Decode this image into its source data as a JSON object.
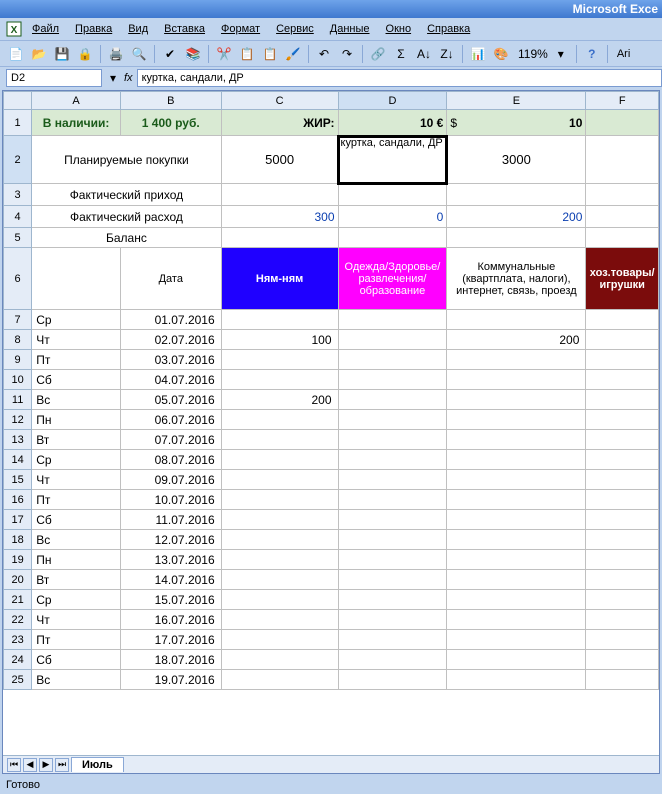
{
  "app": {
    "title": "Microsoft Exce"
  },
  "menu": {
    "file": "Файл",
    "edit": "Правка",
    "view": "Вид",
    "insert": "Вставка",
    "format": "Формат",
    "tools": "Сервис",
    "data": "Данные",
    "window": "Окно",
    "help": "Справка"
  },
  "toolbar": {
    "zoom": "119%",
    "font": "Ari"
  },
  "namebox": {
    "cell": "D2",
    "fx": "fx",
    "formula": "куртка, сандали, ДР"
  },
  "columns": [
    "A",
    "B",
    "C",
    "D",
    "E",
    "F"
  ],
  "row1": {
    "A": "В наличии:",
    "B": "1 400 руб.",
    "C": "ЖИР:",
    "D": "10 €",
    "E_prefix": "$",
    "E_value": "10"
  },
  "row2": {
    "plan_label": "Планируемые покупки",
    "C": "5000",
    "D": "куртка, сандали, ДР",
    "E": "3000"
  },
  "row3": {
    "label": "Фактический приход"
  },
  "row4": {
    "label": "Фактический расход",
    "C": "300",
    "D": "0",
    "E": "200"
  },
  "row5": {
    "label": "Баланс"
  },
  "row6": {
    "date": "Дата",
    "nyam": "Ням-ням",
    "health": "Одежда/Здоровье/развлечения/образование",
    "komm": "Коммунальные (квартплата, налоги), интернет, связь, проезд",
    "hoz": "хоз.товары/игрушки"
  },
  "rows": [
    {
      "n": 7,
      "day": "Ср",
      "date": "01.07.2016",
      "C": "",
      "D": "",
      "E": ""
    },
    {
      "n": 8,
      "day": "Чт",
      "date": "02.07.2016",
      "C": "100",
      "D": "",
      "E": "200"
    },
    {
      "n": 9,
      "day": "Пт",
      "date": "03.07.2016",
      "C": "",
      "D": "",
      "E": ""
    },
    {
      "n": 10,
      "day": "Сб",
      "date": "04.07.2016",
      "C": "",
      "D": "",
      "E": ""
    },
    {
      "n": 11,
      "day": "Вс",
      "date": "05.07.2016",
      "C": "200",
      "D": "",
      "E": ""
    },
    {
      "n": 12,
      "day": "Пн",
      "date": "06.07.2016",
      "C": "",
      "D": "",
      "E": ""
    },
    {
      "n": 13,
      "day": "Вт",
      "date": "07.07.2016",
      "C": "",
      "D": "",
      "E": ""
    },
    {
      "n": 14,
      "day": "Ср",
      "date": "08.07.2016",
      "C": "",
      "D": "",
      "E": ""
    },
    {
      "n": 15,
      "day": "Чт",
      "date": "09.07.2016",
      "C": "",
      "D": "",
      "E": ""
    },
    {
      "n": 16,
      "day": "Пт",
      "date": "10.07.2016",
      "C": "",
      "D": "",
      "E": ""
    },
    {
      "n": 17,
      "day": "Сб",
      "date": "11.07.2016",
      "C": "",
      "D": "",
      "E": ""
    },
    {
      "n": 18,
      "day": "Вс",
      "date": "12.07.2016",
      "C": "",
      "D": "",
      "E": ""
    },
    {
      "n": 19,
      "day": "Пн",
      "date": "13.07.2016",
      "C": "",
      "D": "",
      "E": ""
    },
    {
      "n": 20,
      "day": "Вт",
      "date": "14.07.2016",
      "C": "",
      "D": "",
      "E": ""
    },
    {
      "n": 21,
      "day": "Ср",
      "date": "15.07.2016",
      "C": "",
      "D": "",
      "E": ""
    },
    {
      "n": 22,
      "day": "Чт",
      "date": "16.07.2016",
      "C": "",
      "D": "",
      "E": ""
    },
    {
      "n": 23,
      "day": "Пт",
      "date": "17.07.2016",
      "C": "",
      "D": "",
      "E": ""
    },
    {
      "n": 24,
      "day": "Сб",
      "date": "18.07.2016",
      "C": "",
      "D": "",
      "E": ""
    },
    {
      "n": 25,
      "day": "Вс",
      "date": "19.07.2016",
      "C": "",
      "D": "",
      "E": ""
    }
  ],
  "tabs": {
    "sheet": "Июль"
  },
  "status": {
    "ready": "Готово"
  }
}
